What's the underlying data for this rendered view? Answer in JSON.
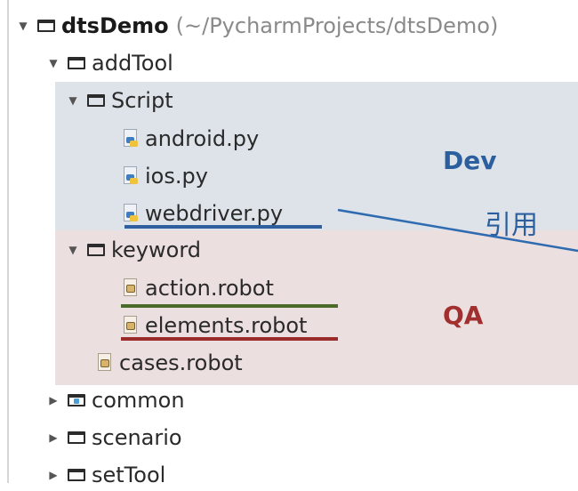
{
  "tree": {
    "root": {
      "name": "dtsDemo",
      "path": "(~/PycharmProjects/dtsDemo)"
    },
    "addTool": "addTool",
    "script": "Script",
    "android": "android.py",
    "ios": "ios.py",
    "webdriver": "webdriver.py",
    "keyword": "keyword",
    "action": "action.robot",
    "elements": "elements.robot",
    "cases": "cases.robot",
    "common": "common",
    "scenario": "scenario",
    "setTool": "setTool"
  },
  "annotations": {
    "dev": "Dev",
    "qa": "QA",
    "reference": "引用"
  },
  "colors": {
    "dev_region": "#dde3e9",
    "qa_region": "#ecdfdf",
    "dev_text": "#2b5f9e",
    "qa_text": "#a22f2f",
    "underline_blue": "#2f5f9e",
    "underline_green": "#4a6b2a",
    "underline_red": "#9a2b2b"
  }
}
